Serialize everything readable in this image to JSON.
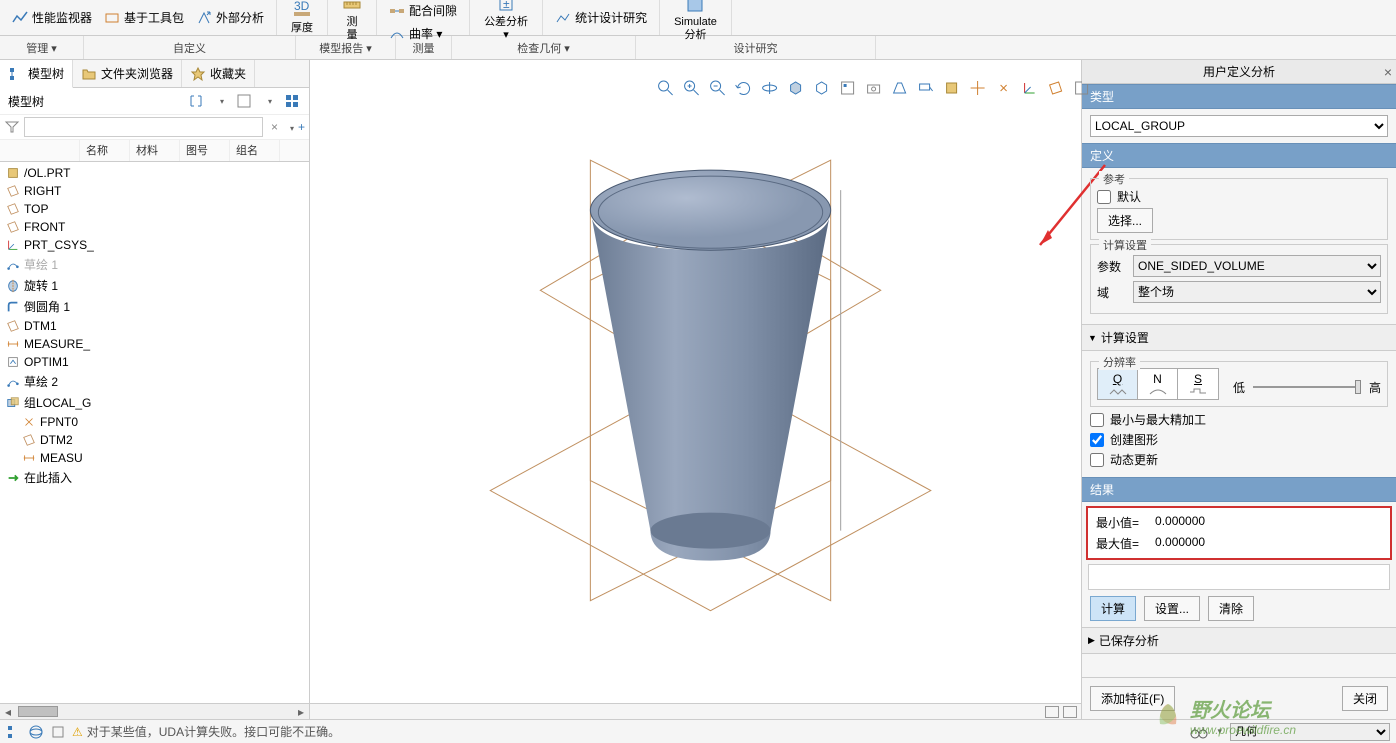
{
  "ribbon": {
    "groups": [
      {
        "items": [
          {
            "label": "性能监视器",
            "icon": "perf-monitor"
          },
          {
            "label": "基于工具包",
            "icon": "toolkit"
          },
          {
            "label": "外部分析",
            "icon": "external-analysis"
          }
        ]
      },
      {
        "big": {
          "label": "厚度",
          "icon": "thickness"
        }
      },
      {
        "big": {
          "label": "测\n量",
          "icon": "measure-big"
        }
      },
      {
        "items": [
          {
            "label": "配合间隙",
            "icon": "clearance"
          },
          {
            "label": "曲率 ▾",
            "icon": "curvature"
          }
        ]
      },
      {
        "big": {
          "label": "公差分析\n▾",
          "icon": "tolerance"
        }
      },
      {
        "items": [
          {
            "label": "统计设计研究",
            "icon": "stat-study"
          }
        ]
      },
      {
        "big": {
          "label": "Simulate\n分析",
          "icon": "simulate"
        }
      }
    ]
  },
  "ribbon2": {
    "segs": [
      "管理 ▾",
      "自定义",
      "模型报告 ▾",
      "测量",
      "检查几何 ▾",
      "设计研究"
    ]
  },
  "left_tabs": [
    {
      "label": "模型树",
      "icon": "model-tree",
      "active": true
    },
    {
      "label": "文件夹浏览器",
      "icon": "folder-browser"
    },
    {
      "label": "收藏夹",
      "icon": "favorites"
    }
  ],
  "tree_header": {
    "title": "模型树"
  },
  "filter": {
    "placeholder": ""
  },
  "col_headers": [
    "",
    "名称",
    "材料",
    "图号",
    "组名"
  ],
  "tree_items": [
    {
      "label": "/OL.PRT",
      "icon": "part",
      "indent": 0
    },
    {
      "label": "RIGHT",
      "icon": "datum-plane",
      "indent": 0
    },
    {
      "label": "TOP",
      "icon": "datum-plane",
      "indent": 0
    },
    {
      "label": "FRONT",
      "icon": "datum-plane",
      "indent": 0
    },
    {
      "label": "PRT_CSYS_",
      "icon": "csys",
      "indent": 0
    },
    {
      "label": "草绘 1",
      "icon": "sketch",
      "indent": 0,
      "dim": true
    },
    {
      "label": "旋转 1",
      "icon": "revolve",
      "indent": 0
    },
    {
      "label": "倒圆角 1",
      "icon": "round",
      "indent": 0
    },
    {
      "label": "DTM1",
      "icon": "datum-plane",
      "indent": 0
    },
    {
      "label": "MEASURE_",
      "icon": "measure",
      "indent": 0
    },
    {
      "label": "OPTIM1",
      "icon": "optim",
      "indent": 0
    },
    {
      "label": "草绘 2",
      "icon": "sketch",
      "indent": 0
    },
    {
      "label": "组LOCAL_G",
      "icon": "group",
      "indent": 0
    },
    {
      "label": "FPNT0",
      "icon": "point",
      "indent": 1
    },
    {
      "label": "DTM2",
      "icon": "datum-plane",
      "indent": 1
    },
    {
      "label": "MEASU",
      "icon": "measure",
      "indent": 1
    },
    {
      "label": "在此插入",
      "icon": "insert-here",
      "indent": 0
    }
  ],
  "right": {
    "title": "用户定义分析",
    "sections": {
      "type": "类型",
      "type_value": "LOCAL_GROUP",
      "define": "定义",
      "reference": "参考",
      "default_chk": "默认",
      "select_btn": "选择...",
      "calc_settings": "计算设置",
      "param_label": "参数",
      "param_value": "ONE_SIDED_VOLUME",
      "domain_label": "域",
      "domain_value": "整个场",
      "calc_settings2": "计算设置",
      "resolution": "分辨率",
      "res_opts": [
        "Q",
        "N",
        "S"
      ],
      "low": "低",
      "high": "高",
      "minmax_chk": "最小与最大精加工",
      "create_graph_chk": "创建图形",
      "dynamic_update_chk": "动态更新",
      "results": "结果",
      "min_label": "最小值=",
      "min_value": "0.000000",
      "max_label": "最大值=",
      "max_value": "0.000000",
      "compute_btn": "计算",
      "settings_btn": "设置...",
      "clear_btn": "清除",
      "saved_analysis": "已保存分析",
      "add_feature_btn": "添加特征(F)",
      "close_btn": "关闭"
    }
  },
  "status": {
    "msg": "对于某些值，UDA计算失败。接口可能不正确。",
    "filter_value": "几何"
  },
  "watermark": {
    "text1": "野火论坛",
    "text2": "www.proewildfire.cn"
  }
}
